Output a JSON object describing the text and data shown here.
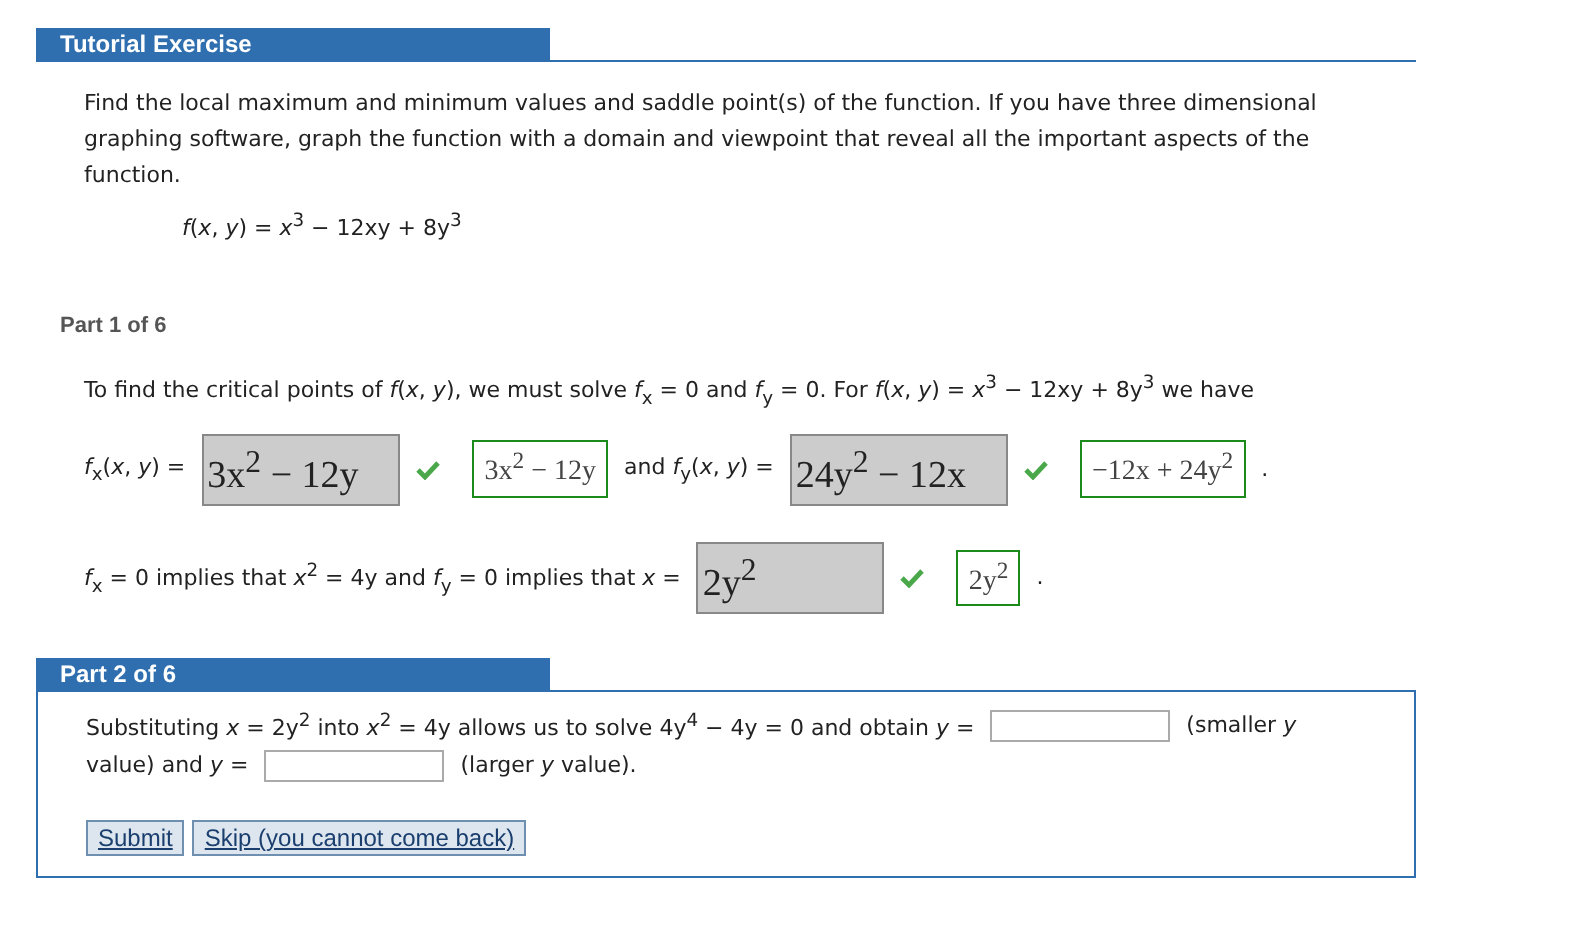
{
  "tutorial": {
    "title": "Tutorial Exercise",
    "prompt": "Find the local maximum and minimum values and saddle point(s) of the function. If you have three dimensional graphing software, graph the function with a domain and viewpoint that reveal all the important aspects of the function.",
    "formula": "*f*(*x*, *y*) = *x*$^{3}$ − 12xy + 8y$^{3}$"
  },
  "part1": {
    "title": "Part 1 of 6",
    "intro": "To find the critical points of  *f*(*x*, *y*),  we must solve  *f*$_{x}$ = 0 and *f*$_{y}$ = 0.  For  *f*(*x*, *y*) = *x*$^{3}$ − 12xy + 8y$^{3}$  we have",
    "rows": [
      {
        "segments": [
          {
            "kind": "text",
            "text": "*f*$_{x}$(*x*, *y*) ="
          },
          {
            "kind": "answer",
            "text": "3x$^{2}$ − 12y",
            "correct": true
          },
          {
            "kind": "key",
            "text": "3x$^{2}$ − 12y"
          },
          {
            "kind": "text",
            "text": "and *f*$_{y}$(*x*, *y*) ="
          },
          {
            "kind": "answer",
            "text": "24y$^{2}$ − 12x",
            "correct": true
          },
          {
            "kind": "key",
            "text": "−12x + 24y$^{2}$"
          },
          {
            "kind": "text",
            "text": "."
          }
        ]
      },
      {
        "segments": [
          {
            "kind": "text",
            "text": "*f*$_{x}$ = 0  implies that  *x*$^{2}$ = 4y  and  *f*$_{y}$ = 0  implies that *x* ="
          },
          {
            "kind": "answer",
            "text": "2y$^{2}$",
            "correct": true
          },
          {
            "kind": "key",
            "text": "2y$^{2}$"
          },
          {
            "kind": "text",
            "text": "."
          }
        ]
      }
    ]
  },
  "part2": {
    "title": "Part 2 of 6",
    "lines": [
      {
        "segments": [
          {
            "kind": "text",
            "text": "Substituting  *x* = 2y$^{2}$  into  *x*$^{2}$ = 4y  allows us to solve  4y$^{4}$ − 4y = 0  and obtain *y* ="
          },
          {
            "kind": "input"
          },
          {
            "kind": "text",
            "text": "(smaller *y*"
          }
        ]
      },
      {
        "segments": [
          {
            "kind": "text",
            "text": "value) and *y* ="
          },
          {
            "kind": "input"
          },
          {
            "kind": "text",
            "text": "(larger *y* value)."
          }
        ]
      }
    ],
    "buttons": [
      "Submit",
      "Skip (you cannot come back)"
    ]
  }
}
